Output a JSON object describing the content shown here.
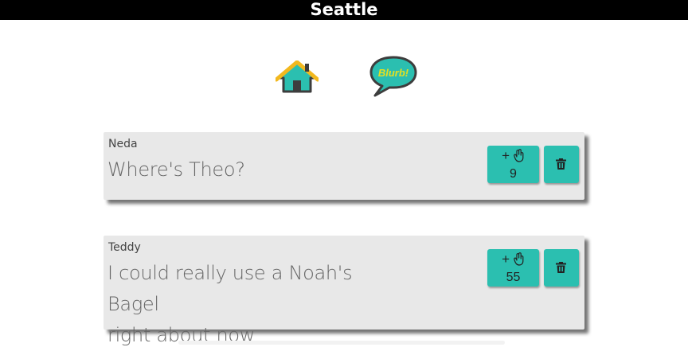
{
  "header": {
    "title": "Seattle"
  },
  "nav": {
    "home_icon": "home-icon",
    "blurb_icon": "speech-bubble-icon",
    "blurb_label": "Blurb!"
  },
  "colors": {
    "accent": "#2bbfb0",
    "card": "#e8e8e8",
    "header": "#000000",
    "blurb_text": "#e6e020"
  },
  "posts": [
    {
      "author": "Neda",
      "lines": [
        "Where's Theo?"
      ],
      "vote_label": "+",
      "votes": "9"
    },
    {
      "author": "Teddy",
      "lines": [
        "I could really use a Noah's Bagel",
        "right about now"
      ],
      "vote_label": "+",
      "votes": "55"
    }
  ]
}
